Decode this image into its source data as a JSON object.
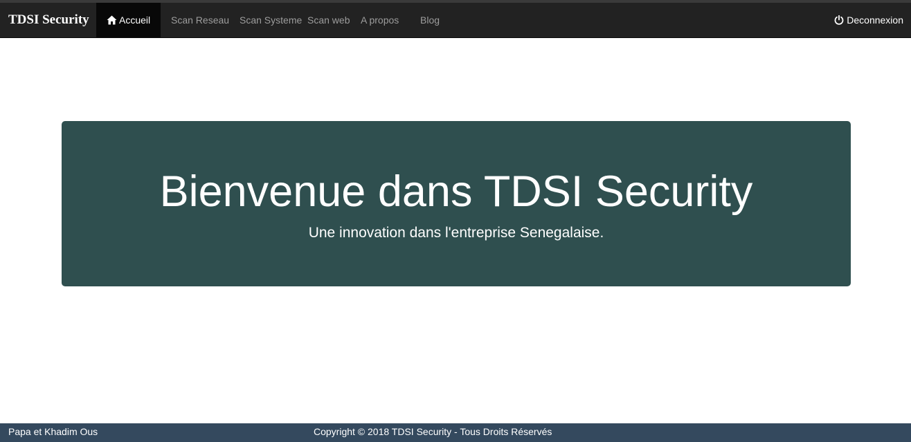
{
  "navbar": {
    "brand": "TDSI Security",
    "items": [
      {
        "label": "Accueil",
        "icon": "home-icon",
        "active": true
      },
      {
        "label": "Scan Reseau"
      },
      {
        "label": "Scan Systeme"
      },
      {
        "label": "Scan web"
      },
      {
        "label": "A propos"
      },
      {
        "label": "Blog"
      }
    ],
    "logout": {
      "label": "Deconnexion",
      "icon": "power-icon"
    }
  },
  "hero": {
    "title": "Bienvenue dans TDSI Security",
    "subtitle": "Une innovation dans l'entreprise Senegalaise."
  },
  "footer": {
    "authors": "Papa et Khadim Ous",
    "copyright": "Copyright © 2018 TDSI Security - Tous Droits Réservés"
  },
  "colors": {
    "navbar_bg": "#222222",
    "nav_active_bg": "#080808",
    "nav_text": "#9d9d9d",
    "hero_bg": "#2f4f4f",
    "footer_bg": "#34495e"
  }
}
